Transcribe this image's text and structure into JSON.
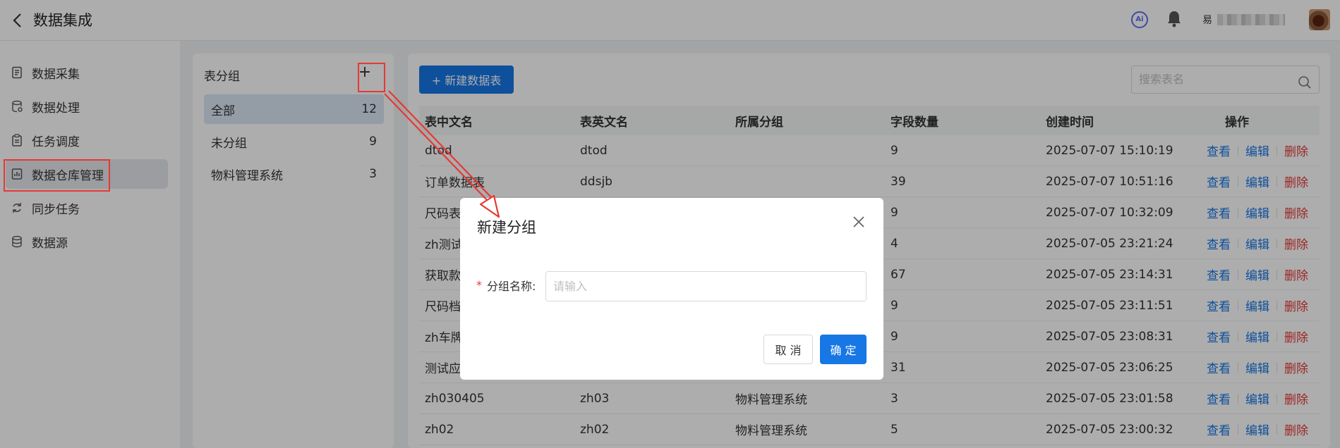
{
  "header": {
    "title": "数据集成",
    "ai_badge": "Ai",
    "user_name": "易"
  },
  "nav": {
    "items": [
      {
        "label": "数据采集",
        "icon": "document-list-icon"
      },
      {
        "label": "数据处理",
        "icon": "database-cog-icon"
      },
      {
        "label": "任务调度",
        "icon": "clipboard-icon"
      },
      {
        "label": "数据仓库管理",
        "icon": "warehouse-chart-icon",
        "active": true
      },
      {
        "label": "同步任务",
        "icon": "sync-icon"
      },
      {
        "label": "数据源",
        "icon": "database-icon"
      }
    ]
  },
  "groups": {
    "title": "表分组",
    "add_label": "+",
    "items": [
      {
        "label": "全部",
        "count": "12",
        "active": true
      },
      {
        "label": "未分组",
        "count": "9"
      },
      {
        "label": "物料管理系统",
        "count": "3"
      }
    ]
  },
  "toolbar": {
    "new_table_label": "+ 新建数据表",
    "search_placeholder": "搜索表名"
  },
  "table": {
    "columns": [
      "表中文名",
      "表英文名",
      "所属分组",
      "字段数量",
      "创建时间",
      "操作"
    ],
    "actions": {
      "view": "查看",
      "edit": "编辑",
      "delete": "删除"
    },
    "rows": [
      {
        "cn": "dtod",
        "en": "dtod",
        "group": "",
        "fields": "9",
        "created": "2025-07-07 15:10:19"
      },
      {
        "cn": "订单数据表",
        "en": "ddsjb",
        "group": "",
        "fields": "39",
        "created": "2025-07-07 10:51:16"
      },
      {
        "cn": "尺码表",
        "en": "",
        "group": "",
        "fields": "9",
        "created": "2025-07-07 10:32:09"
      },
      {
        "cn": "zh测试",
        "en": "",
        "group": "",
        "fields": "4",
        "created": "2025-07-05 23:21:24"
      },
      {
        "cn": "获取款",
        "en": "",
        "group": "",
        "fields": "67",
        "created": "2025-07-05 23:14:31"
      },
      {
        "cn": "尺码档",
        "en": "",
        "group": "",
        "fields": "9",
        "created": "2025-07-05 23:11:51"
      },
      {
        "cn": "zh车牌",
        "en": "",
        "group": "",
        "fields": "9",
        "created": "2025-07-05 23:08:31"
      },
      {
        "cn": "测试应",
        "en": "",
        "group": "",
        "fields": "31",
        "created": "2025-07-05 23:06:25"
      },
      {
        "cn": "zh030405",
        "en": "zh03",
        "group": "物料管理系统",
        "fields": "3",
        "created": "2025-07-05 23:01:58"
      },
      {
        "cn": "zh02",
        "en": "zh02",
        "group": "物料管理系统",
        "fields": "5",
        "created": "2025-07-05 23:00:32"
      }
    ]
  },
  "dialog": {
    "title": "新建分组",
    "required_mark": "*",
    "field_label": "分组名称:",
    "field_placeholder": "请输入",
    "field_value": "",
    "cancel_label": "取 消",
    "ok_label": "确 定"
  },
  "colors": {
    "primary": "#1677e5",
    "danger": "#e53935",
    "annotation": "#e53935"
  }
}
